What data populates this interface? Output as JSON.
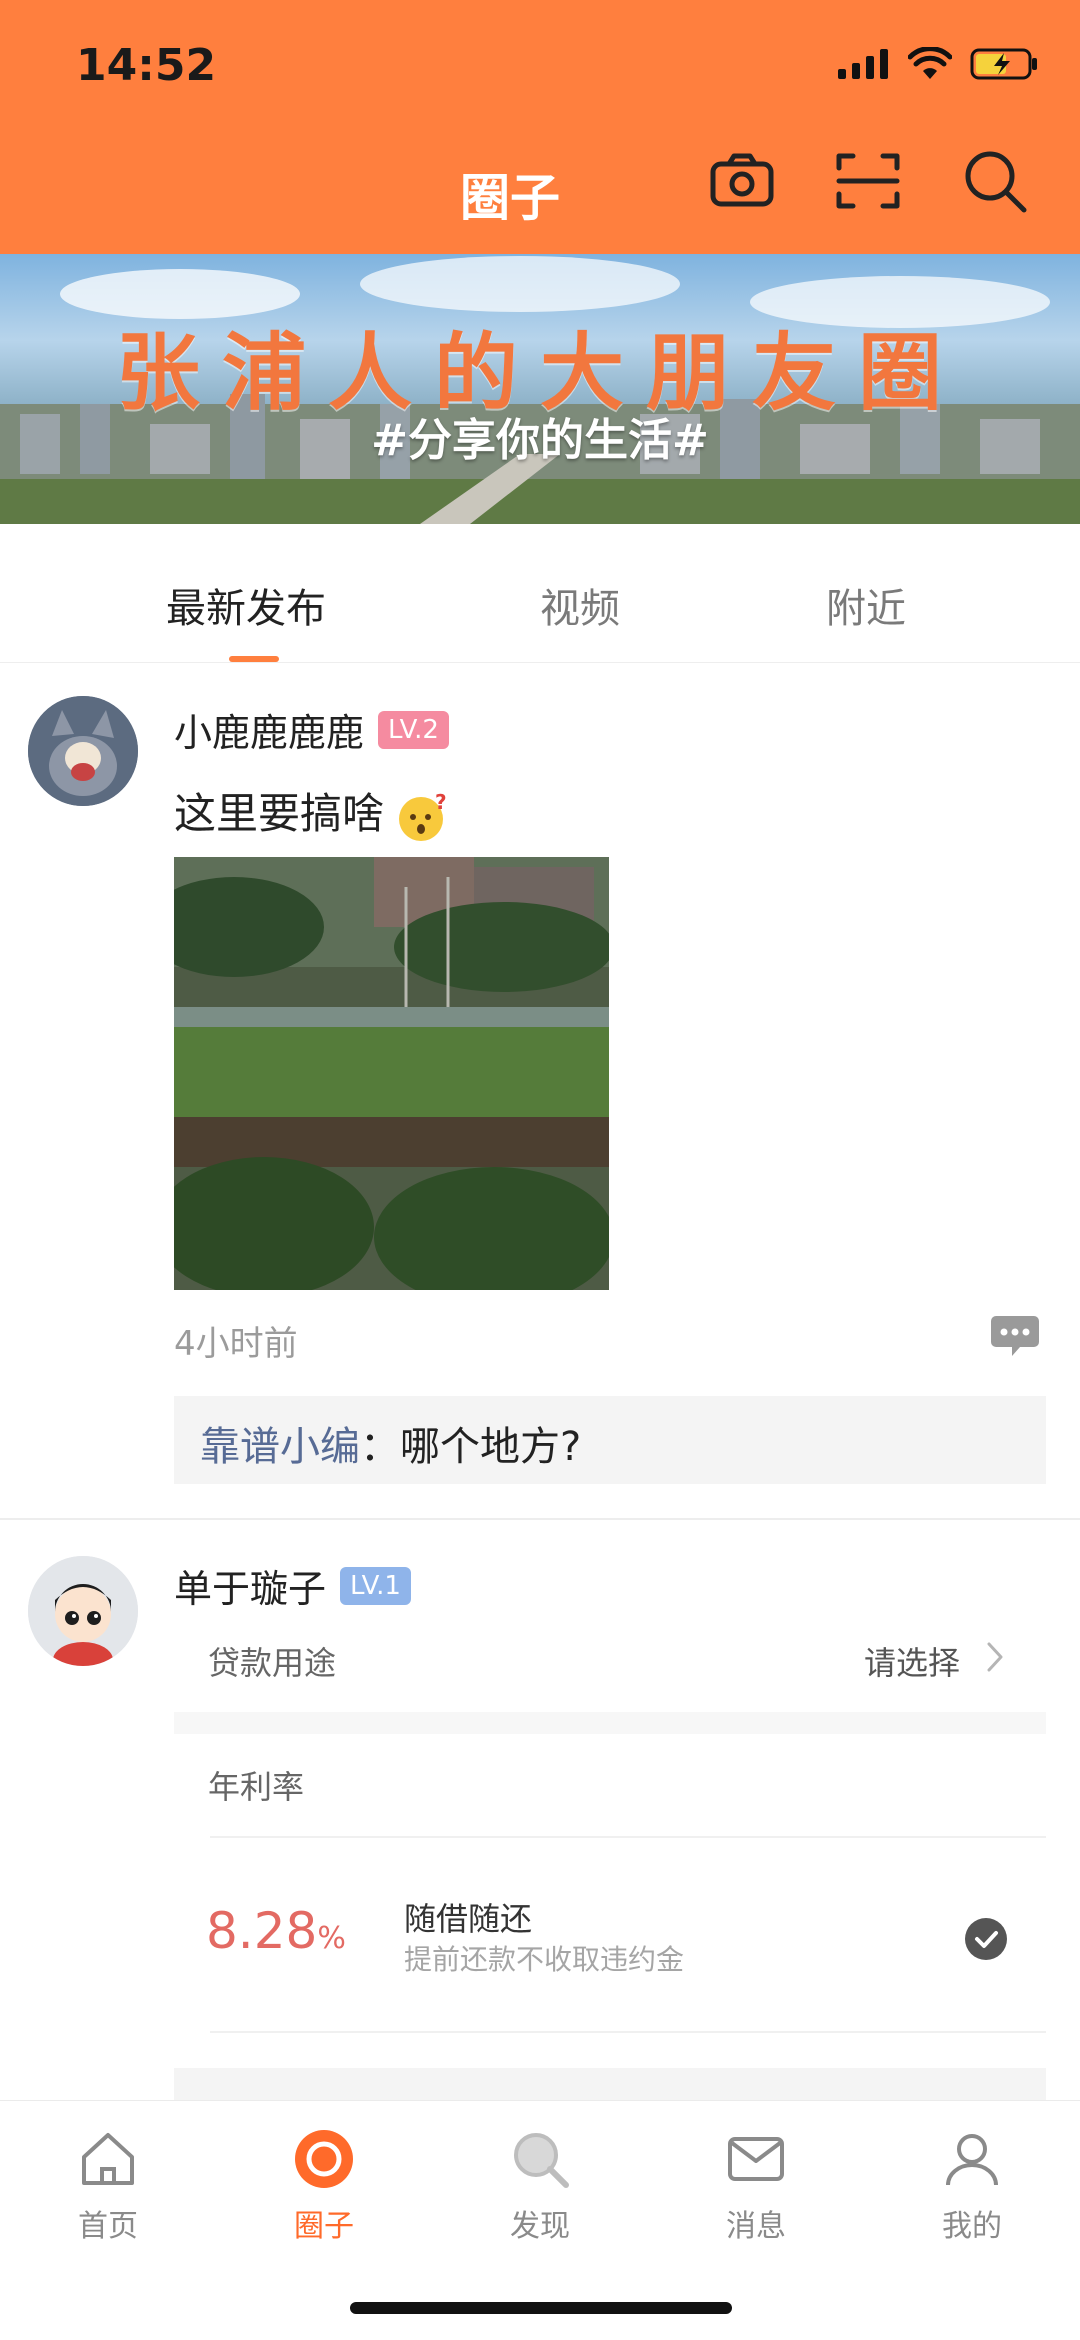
{
  "status_bar": {
    "time": "14:52"
  },
  "header": {
    "title": "圈子",
    "icons": [
      "camera-icon",
      "scan-icon",
      "search-icon"
    ],
    "accent": "#FF7F3E"
  },
  "banner": {
    "title": "张浦人的大朋友圈",
    "subtitle": "#分享你的生活#"
  },
  "tabs": [
    {
      "label": "最新发布",
      "active": true
    },
    {
      "label": "视频"
    },
    {
      "label": "附近"
    }
  ],
  "posts": [
    {
      "username": "小鹿鹿鹿鹿",
      "level": "LV.2",
      "text": "这里要搞啥",
      "time": "4小时前",
      "comments": [
        {
          "author": "靠谱小编",
          "separator": "：",
          "text": "哪个地方?"
        }
      ]
    },
    {
      "username": "单于璇子",
      "level": "LV.1"
    }
  ],
  "loan_ad": {
    "purpose_label": "贷款用途",
    "purpose_value": "请选择",
    "rate_label": "年利率",
    "rate_value": "8.28",
    "rate_unit": "%",
    "plan_title": "随借随还",
    "plan_subtitle": "提前还款不收取违约金"
  },
  "bottom_nav": [
    {
      "label": "首页",
      "icon": "home-icon"
    },
    {
      "label": "圈子",
      "icon": "circle-icon",
      "active": true
    },
    {
      "label": "发现",
      "icon": "discover-icon"
    },
    {
      "label": "消息",
      "icon": "message-icon"
    },
    {
      "label": "我的",
      "icon": "profile-icon"
    }
  ]
}
